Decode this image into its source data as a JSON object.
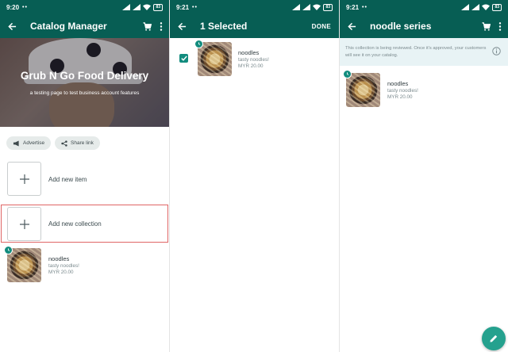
{
  "colors": {
    "header": "#075e54",
    "accent": "#128c7e",
    "fab": "#25a18e",
    "highlight_outline": "#e06666"
  },
  "panel1": {
    "status_time": "9:20",
    "battery": "83",
    "title": "Catalog Manager",
    "icons": [
      "back-arrow-icon",
      "cart-icon",
      "more-vert-icon"
    ],
    "cover": {
      "business_name": "Grub N Go Food Delivery",
      "description": "a testing page to test business account features"
    },
    "chips": [
      {
        "label": "Advertise",
        "icon": "megaphone-icon"
      },
      {
        "label": "Share link",
        "icon": "share-icon"
      }
    ],
    "add_item_label": "Add new item",
    "add_collection_label": "Add new collection",
    "item": {
      "name": "noodles",
      "description": "tasty noodles!",
      "price": "MYR 20.00",
      "status_icon": "clock-icon"
    }
  },
  "panel2": {
    "status_time": "9:21",
    "battery": "83",
    "title": "1 Selected",
    "done_label": "DONE",
    "item": {
      "name": "noodles",
      "description": "tasty noodles!",
      "price": "MYR 20.00",
      "checked": true
    }
  },
  "panel3": {
    "status_time": "9:21",
    "battery": "83",
    "title": "noodle series",
    "notice": "This collection is being reviewed. Once it's approved, your customers will see it on your catalog.",
    "item": {
      "name": "noodles",
      "description": "tasty noodles!",
      "price": "MYR 20.00"
    },
    "fab_icon": "pencil-icon"
  }
}
